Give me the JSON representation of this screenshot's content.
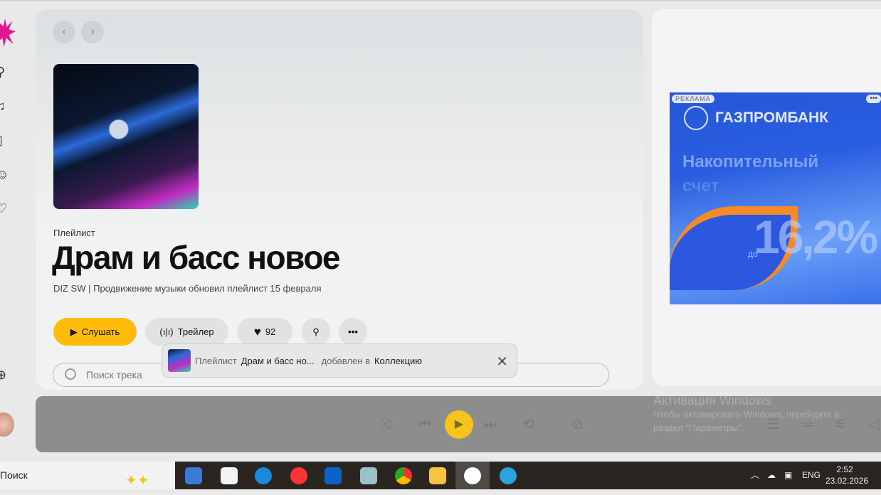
{
  "nav": {
    "back": "‹",
    "forward": "›"
  },
  "playlist": {
    "type": "Плейлист",
    "title": "Драм и басс новое",
    "subtitle": "DIZ SW | Продвижение музыки обновил плейлист 15 февраля",
    "likes": "92"
  },
  "actions": {
    "listen": "Слушать",
    "trailer": "Трейлер"
  },
  "search": {
    "placeholder": "Поиск трека"
  },
  "toast": {
    "prefix": "Плейлист",
    "name": "Драм и басс но...",
    "middle": "добавлен в",
    "target": "Коллекцию"
  },
  "ad": {
    "tag": "РЕКЛАМА",
    "dots": "•••",
    "brand": "ГАЗПРОМБАНК",
    "line1": "Накопительный",
    "line2": "счет",
    "prefix": "до",
    "rate": "16,2%"
  },
  "watermark": {
    "title": "Активация Windows",
    "line1": "Чтобы активировать Windows, перейдите в",
    "line2": "раздел \"Параметры\"."
  },
  "taskbar": {
    "search": "Поиск",
    "lang": "ENG",
    "time": "2:52",
    "date": "23.02.2026"
  },
  "colors": {
    "accent": "#ffbc0d",
    "logo": "#e0168f",
    "ad_bg": "#2556d8"
  }
}
